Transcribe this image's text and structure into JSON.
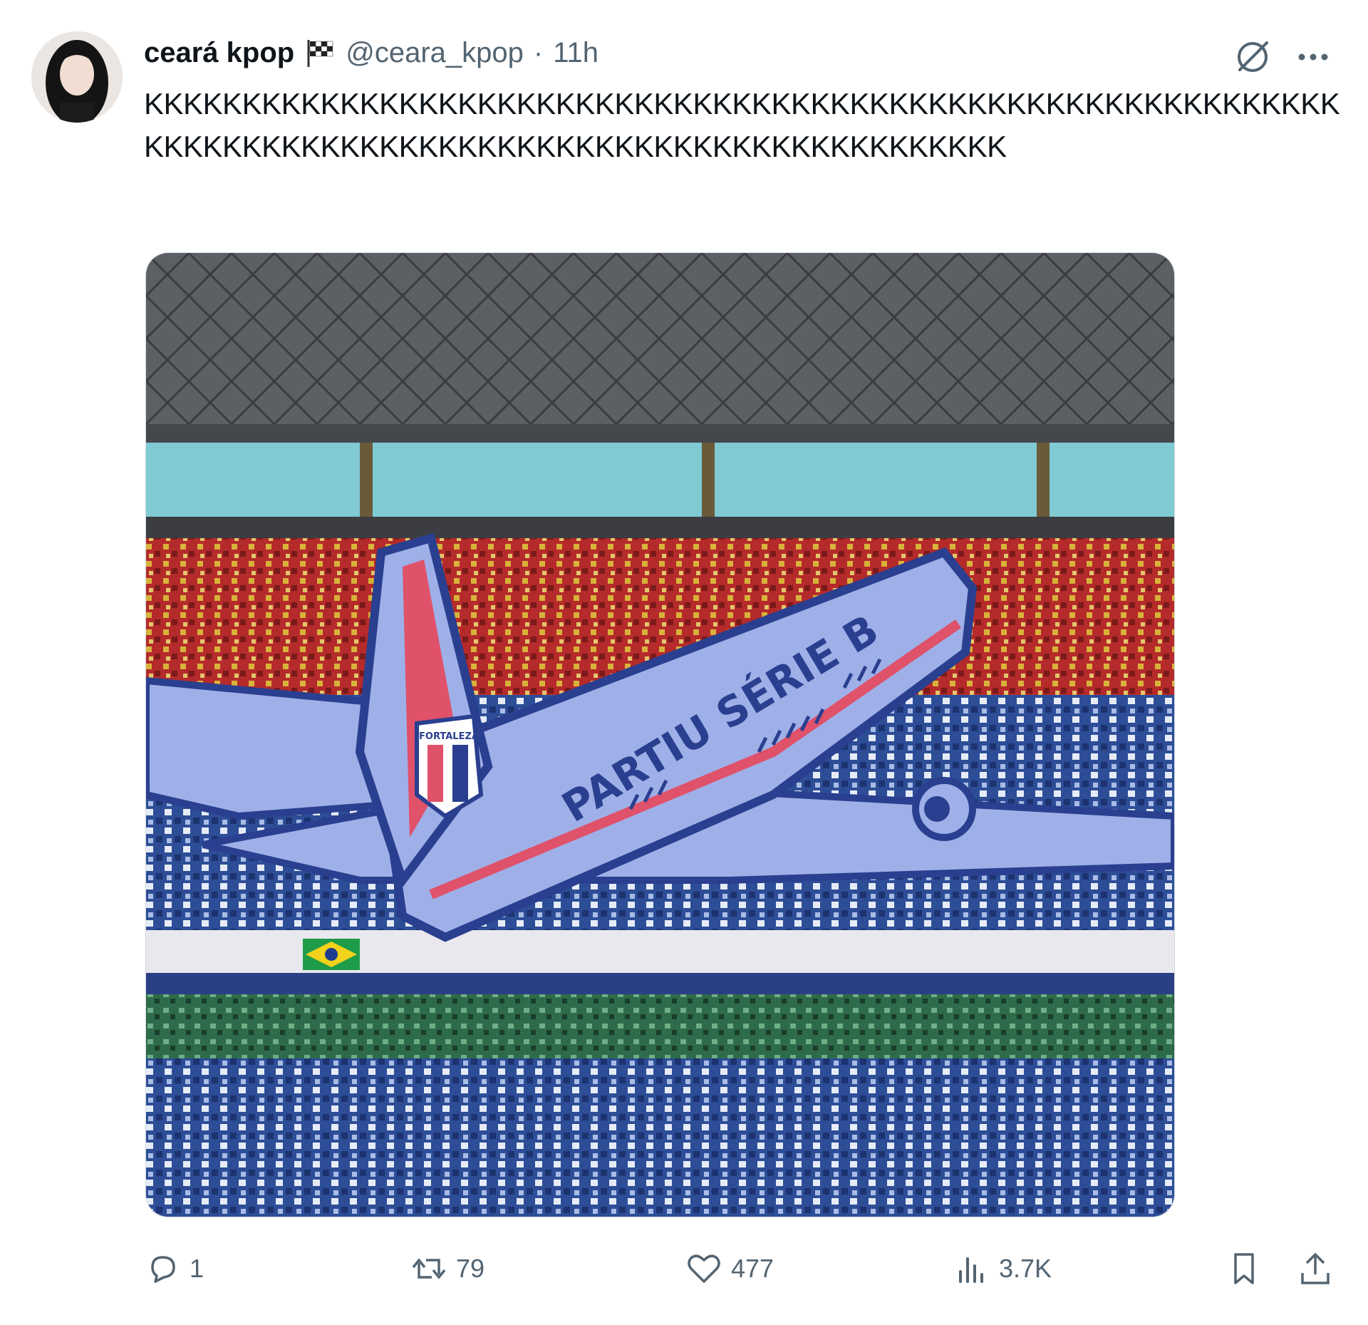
{
  "tweet": {
    "display_name": "ceará kpop",
    "handle": "@ceara_kpop",
    "separator": "·",
    "time": "11h",
    "text": "KKKKKKKKKKKKKKKKKKKKKKKKKKKKKKKKKKKKKKKKKKKKKKKKKKKKKKKKKKKKKKKKKKKKKKKKKKKKKKKKKKKKKKKKKKKKKKKKKKKKKKKKK",
    "image_banner_text": "PARTIU SÉRIE B",
    "image_crest_text": "FORTALEZA"
  },
  "actions": {
    "replies": "1",
    "reposts": "79",
    "likes": "477",
    "views": "3.7K"
  },
  "icons": {
    "header": [
      "flag-icon",
      "grok-icon",
      "more-icon"
    ],
    "actions": [
      "reply-icon",
      "repost-icon",
      "like-icon",
      "views-icon",
      "bookmark-icon",
      "share-icon"
    ]
  },
  "colors": {
    "text": "#0f1419",
    "secondary": "#536471",
    "plane_body": "#9fb0e8",
    "plane_stripe": "#e0516a",
    "plane_outline": "#2a3f8f"
  }
}
